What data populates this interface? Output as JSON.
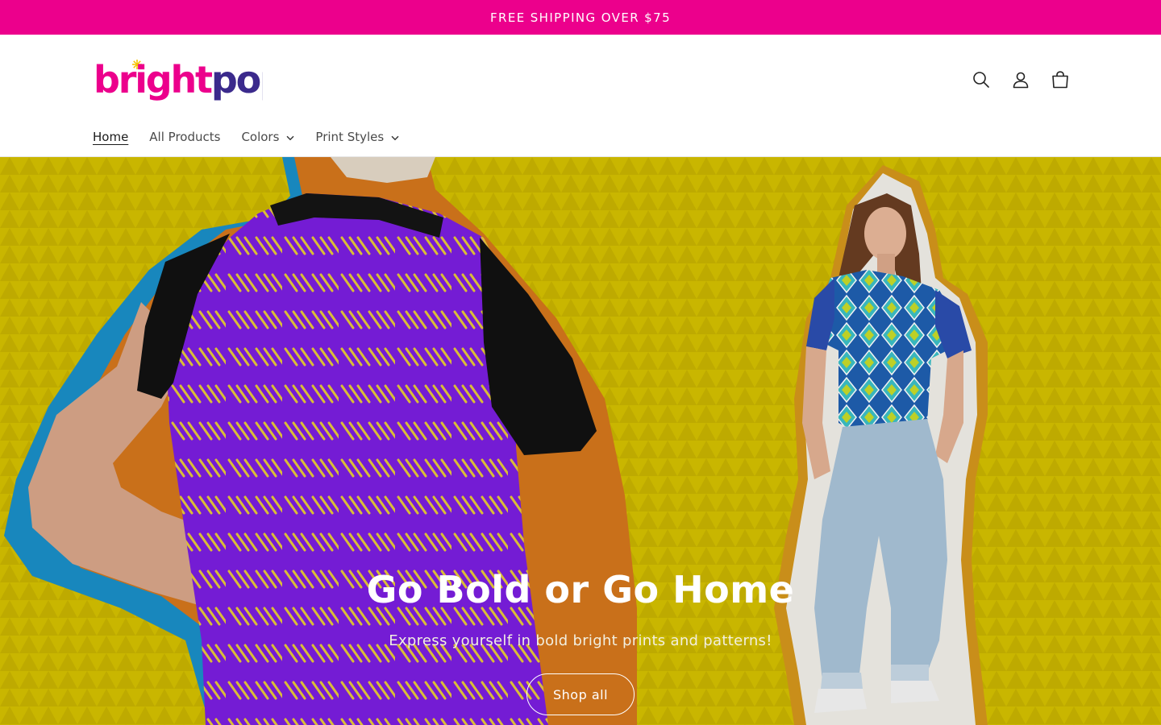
{
  "announcement": {
    "text": "FREE SHIPPING OVER $75"
  },
  "brand": {
    "name": "brightpop",
    "colors": {
      "magenta": "#ec008c",
      "purple": "#3b2a8c",
      "accent_yellow": "#f5c400"
    }
  },
  "header": {
    "icons": [
      {
        "name": "search-icon"
      },
      {
        "name": "account-icon"
      },
      {
        "name": "cart-icon"
      }
    ]
  },
  "nav": {
    "items": [
      {
        "label": "Home",
        "active": true,
        "has_dropdown": false
      },
      {
        "label": "All Products",
        "active": false,
        "has_dropdown": false
      },
      {
        "label": "Colors",
        "active": false,
        "has_dropdown": true
      },
      {
        "label": "Print Styles",
        "active": false,
        "has_dropdown": true
      }
    ]
  },
  "hero": {
    "title": "Go Bold or Go Home",
    "subtitle": "Express yourself in bold bright prints and patterns!",
    "button_label": "Shop all",
    "background_color": "#d6c300"
  }
}
